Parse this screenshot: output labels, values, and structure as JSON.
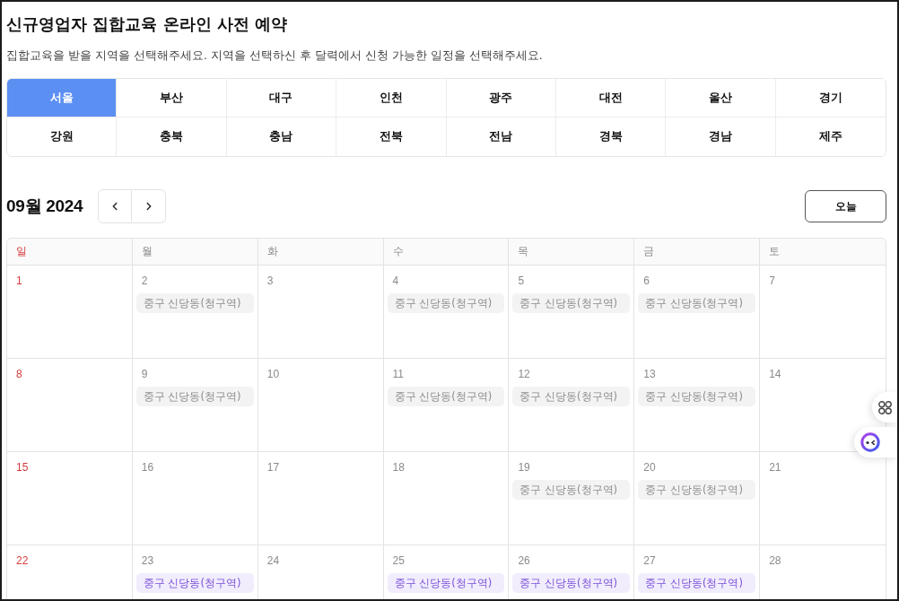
{
  "title": "신규영업자 집합교육 온라인 사전 예약",
  "description": "집합교육을 받을 지역을 선택해주세요. 지역을 선택하신 후 달력에서 신청 가능한 일정을 선택해주세요.",
  "regions": [
    {
      "label": "서울",
      "selected": true
    },
    {
      "label": "부산",
      "selected": false
    },
    {
      "label": "대구",
      "selected": false
    },
    {
      "label": "인천",
      "selected": false
    },
    {
      "label": "광주",
      "selected": false
    },
    {
      "label": "대전",
      "selected": false
    },
    {
      "label": "울산",
      "selected": false
    },
    {
      "label": "경기",
      "selected": false
    },
    {
      "label": "강원",
      "selected": false
    },
    {
      "label": "충북",
      "selected": false
    },
    {
      "label": "충남",
      "selected": false
    },
    {
      "label": "전북",
      "selected": false
    },
    {
      "label": "전남",
      "selected": false
    },
    {
      "label": "경북",
      "selected": false
    },
    {
      "label": "경남",
      "selected": false
    },
    {
      "label": "제주",
      "selected": false
    }
  ],
  "calendar": {
    "month_label": "09월 2024",
    "today_button": "오늘",
    "weekdays": [
      {
        "label": "일",
        "kind": "sunday"
      },
      {
        "label": "월",
        "kind": "weekday"
      },
      {
        "label": "화",
        "kind": "weekday"
      },
      {
        "label": "수",
        "kind": "weekday"
      },
      {
        "label": "목",
        "kind": "weekday"
      },
      {
        "label": "금",
        "kind": "weekday"
      },
      {
        "label": "토",
        "kind": "weekday"
      }
    ],
    "weeks": [
      {
        "days": [
          {
            "date": "1",
            "kind": "sunday"
          },
          {
            "date": "2",
            "kind": "weekday",
            "events": [
              {
                "label": "중구 신당동(청구역)",
                "available": false
              }
            ]
          },
          {
            "date": "3",
            "kind": "weekday"
          },
          {
            "date": "4",
            "kind": "weekday",
            "events": [
              {
                "label": "중구 신당동(청구역)",
                "available": false
              }
            ]
          },
          {
            "date": "5",
            "kind": "weekday",
            "events": [
              {
                "label": "중구 신당동(청구역)",
                "available": false
              }
            ]
          },
          {
            "date": "6",
            "kind": "weekday",
            "events": [
              {
                "label": "중구 신당동(청구역)",
                "available": false
              }
            ]
          },
          {
            "date": "7",
            "kind": "weekday"
          }
        ]
      },
      {
        "days": [
          {
            "date": "8",
            "kind": "sunday"
          },
          {
            "date": "9",
            "kind": "weekday",
            "events": [
              {
                "label": "중구 신당동(청구역)",
                "available": false
              }
            ]
          },
          {
            "date": "10",
            "kind": "weekday"
          },
          {
            "date": "11",
            "kind": "weekday",
            "events": [
              {
                "label": "중구 신당동(청구역)",
                "available": false
              }
            ]
          },
          {
            "date": "12",
            "kind": "weekday",
            "events": [
              {
                "label": "중구 신당동(청구역)",
                "available": false
              }
            ]
          },
          {
            "date": "13",
            "kind": "weekday",
            "events": [
              {
                "label": "중구 신당동(청구역)",
                "available": false
              }
            ]
          },
          {
            "date": "14",
            "kind": "weekday"
          }
        ]
      },
      {
        "days": [
          {
            "date": "15",
            "kind": "sunday"
          },
          {
            "date": "16",
            "kind": "weekday"
          },
          {
            "date": "17",
            "kind": "weekday"
          },
          {
            "date": "18",
            "kind": "weekday"
          },
          {
            "date": "19",
            "kind": "weekday",
            "events": [
              {
                "label": "중구 신당동(청구역)",
                "available": false
              }
            ]
          },
          {
            "date": "20",
            "kind": "weekday",
            "events": [
              {
                "label": "중구 신당동(청구역)",
                "available": false
              }
            ]
          },
          {
            "date": "21",
            "kind": "weekday"
          }
        ]
      },
      {
        "days": [
          {
            "date": "22",
            "kind": "sunday"
          },
          {
            "date": "23",
            "kind": "weekday",
            "events": [
              {
                "label": "중구 신당동(청구역)",
                "available": true
              }
            ]
          },
          {
            "date": "24",
            "kind": "weekday"
          },
          {
            "date": "25",
            "kind": "weekday",
            "events": [
              {
                "label": "중구 신당동(청구역)",
                "available": true
              }
            ]
          },
          {
            "date": "26",
            "kind": "weekday",
            "events": [
              {
                "label": "중구 신당동(청구역)",
                "available": true
              }
            ]
          },
          {
            "date": "27",
            "kind": "weekday",
            "events": [
              {
                "label": "중구 신당동(청구역)",
                "available": true
              }
            ]
          },
          {
            "date": "28",
            "kind": "weekday"
          }
        ]
      }
    ]
  }
}
